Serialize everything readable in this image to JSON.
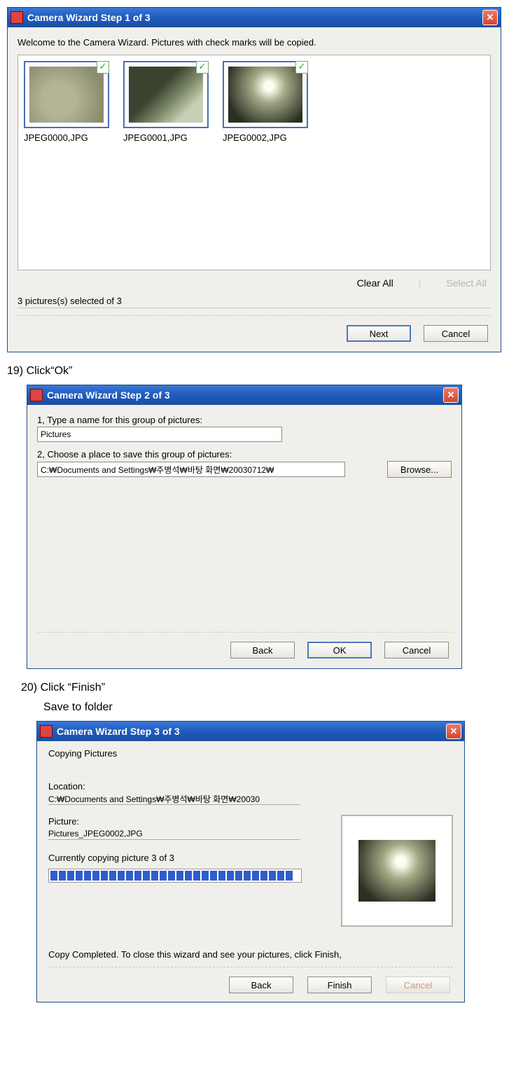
{
  "dialog1": {
    "title": "Camera Wizard Step 1 of 3",
    "welcome": "Welcome to the Camera Wizard.  Pictures with check marks will be copied.",
    "thumbs": [
      "JPEG0000,JPG",
      "JPEG0001,JPG",
      "JPEG0002,JPG"
    ],
    "clear_all": "Clear All",
    "select_all": "Select All",
    "status": "3 pictures(s) selected of 3",
    "next": "Next",
    "cancel": "Cancel"
  },
  "step19": "19) Click“Ok”",
  "dialog2": {
    "title": "Camera Wizard Step 2 of 3",
    "label1": "1, Type a name for this group of pictures:",
    "name_value": "Pictures",
    "label2": "2, Choose a place to save this group of pictures:",
    "path_value": "C:₩Documents and Settings₩주병석₩바탕 화면₩20030712₩",
    "browse": "Browse...",
    "back": "Back",
    "ok": "OK",
    "cancel": "Cancel"
  },
  "step20": "20) Click “Finish”",
  "step20b": "Save to folder",
  "dialog3": {
    "title": "Camera Wizard Step 3 of 3",
    "copying": "Copying Pictures",
    "location_label": "Location:",
    "location_value": "C:₩Documents and Settings₩주병석₩바탕 화면₩20030",
    "picture_label": "Picture:",
    "picture_value": "Pictures_JPEG0002,JPG",
    "progress_text": "Currently copying picture 3 of 3",
    "complete": "Copy Completed.  To close this wizard and see your pictures, click Finish,",
    "back": "Back",
    "finish": "Finish",
    "cancel": "Cancel"
  }
}
